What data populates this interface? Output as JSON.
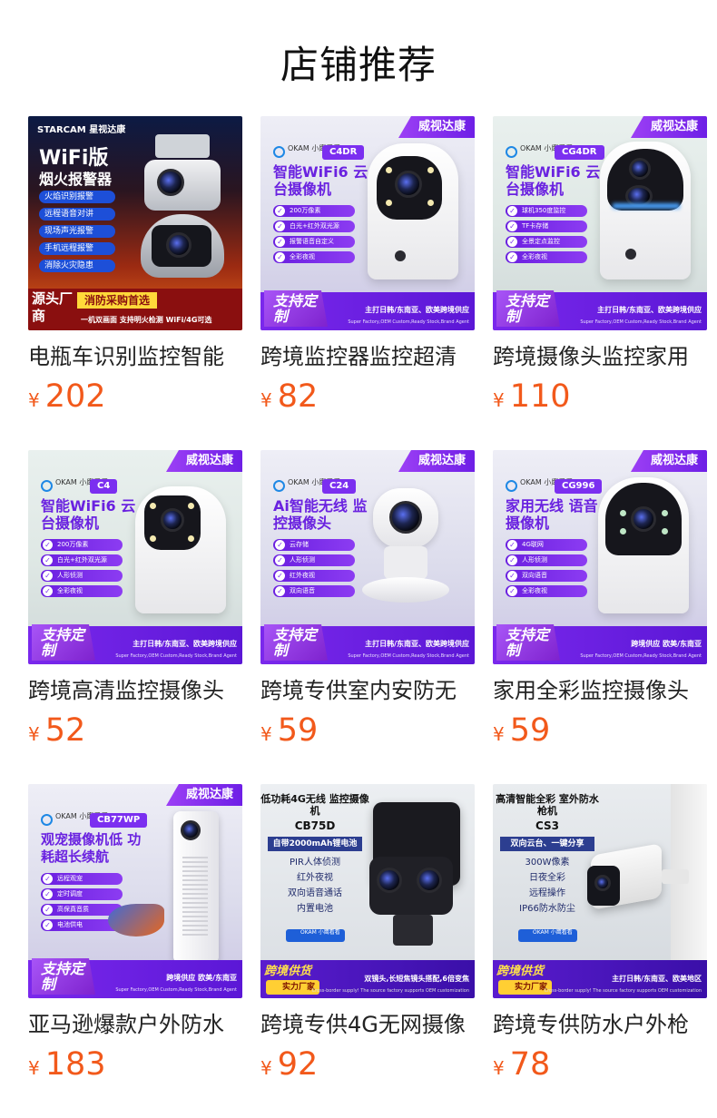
{
  "section_title": "店铺推荐",
  "products": [
    {
      "name": "电瓶车识别监控智能",
      "currency": "¥",
      "price": "202",
      "image": {
        "style": "fire",
        "brand": "STARCAM 星视达康",
        "headline": "WiFi版",
        "subheadline": "烟火报警器",
        "features": [
          "火焰识别报警",
          "远程语音对讲",
          "现场声光报警",
          "手机远程报警",
          "消除火灾隐患"
        ],
        "corner_label": "源头厂商",
        "corner_tag": "消防采购首选",
        "corner_line": "一机双画面 支持明火检测 WiFi/4G可选"
      }
    },
    {
      "name": "跨境监控器监控超清",
      "currency": "¥",
      "price": "82",
      "image": {
        "style": "purple",
        "brand_tag": "威视达康",
        "logo": "OKAM 小鹰看看",
        "model": "C4DR",
        "headline": "智能WiFi6 云台摄像机",
        "features": [
          "200万像素",
          "白光+红外双光源",
          "报警语音自定义",
          "全彩夜视"
        ],
        "customize": "支持定制",
        "bottom_text": "主打日韩/东南亚、欧美跨境供应",
        "bottom_sub": "Super Factory,OEM Custom,Ready Stock,Brand Agent"
      }
    },
    {
      "name": "跨境摄像头监控家用",
      "currency": "¥",
      "price": "110",
      "image": {
        "style": "purple",
        "brand_tag": "威视达康",
        "logo": "OKAM 小鹰看看",
        "model": "CG4DR",
        "headline": "智能WiFi6 云台摄像机",
        "features": [
          "球机350度监控",
          "TF卡存储",
          "全景定点监控",
          "全彩夜视"
        ],
        "customize": "支持定制",
        "bottom_text": "主打日韩/东南亚、欧美跨境供应",
        "bottom_sub": "Super Factory,OEM Custom,Ready Stock,Brand Agent"
      }
    },
    {
      "name": "跨境高清监控摄像头",
      "currency": "¥",
      "price": "52",
      "image": {
        "style": "purple",
        "brand_tag": "威视达康",
        "logo": "OKAM 小鹰看看",
        "model": "C4",
        "headline": "智能WiFi6 云台摄像机",
        "features": [
          "200万像素",
          "白光+红外双光源",
          "人形侦测",
          "全彩夜视"
        ],
        "customize": "支持定制",
        "bottom_text": "主打日韩/东南亚、欧美跨境供应",
        "bottom_sub": "Super Factory,OEM Custom,Ready Stock,Brand Agent"
      }
    },
    {
      "name": "跨境专供室内安防无",
      "currency": "¥",
      "price": "59",
      "image": {
        "style": "purple",
        "brand_tag": "威视达康",
        "logo": "OKAM 小鹰看看",
        "model": "C24",
        "headline": "Ai智能无线 监控摄像头",
        "features": [
          "云存储",
          "人形侦测",
          "红外夜视",
          "双向语音"
        ],
        "customize": "支持定制",
        "bottom_text": "主打日韩/东南亚、欧美跨境供应",
        "bottom_sub": "Super Factory,OEM Custom,Ready Stock,Brand Agent"
      }
    },
    {
      "name": "家用全彩监控摄像头",
      "currency": "¥",
      "price": "59",
      "image": {
        "style": "purple",
        "brand_tag": "威视达康",
        "logo": "OKAM 小鹰看看",
        "model": "CG996",
        "headline": "家用无线 语音摄像机",
        "features": [
          "4G联网",
          "人形侦测",
          "双向语音",
          "全彩夜视"
        ],
        "customize": "支持定制",
        "bottom_text": "跨境供应 欧美/东南亚",
        "bottom_sub": "Super Factory,OEM Custom,Ready Stock,Brand Agent"
      }
    },
    {
      "name": "亚马逊爆款户外防水",
      "currency": "¥",
      "price": "183",
      "image": {
        "style": "purple",
        "brand_tag": "威视达康",
        "logo": "OKAM 小鹰看看",
        "model": "CB77WP",
        "headline": "观宠摄像机低 功耗超长续航",
        "features": [
          "远程观宠",
          "定时调度",
          "高保真音质",
          "电池供电"
        ],
        "customize": "支持定制",
        "bottom_text": "跨境供应 欧美/东南亚",
        "bottom_sub": "Super Factory,OEM Custom,Ready Stock,Brand Agent"
      }
    },
    {
      "name": "跨境专供4G无网摄像",
      "currency": "¥",
      "price": "92",
      "image": {
        "style": "dark",
        "headline": "低功耗4G无线 监控摄像机",
        "model": "CB75D",
        "bar": "自带2000mAh锂电池",
        "features": [
          "PIR人体侦测",
          "红外夜视",
          "双向语音通话",
          "内置电池"
        ],
        "logo": "OKAM 小鹰看看",
        "cross_tag": "跨境供货",
        "factory": "实力厂家",
        "factory_sub": "深圳地区送货上门",
        "cross_text": "双镜头,长短焦镜头搭配,6倍变焦",
        "cross_sub": "Cross-border supply! The source factory supports OEM customization"
      }
    },
    {
      "name": "跨境专供防水户外枪",
      "currency": "¥",
      "price": "78",
      "image": {
        "style": "dark",
        "headline": "高清智能全彩 室外防水枪机",
        "model": "CS3",
        "bar": "双向云台、一键分享",
        "features": [
          "300W像素",
          "日夜全彩",
          "远程操作",
          "IP66防水防尘"
        ],
        "logo": "OKAM 小鹰看看",
        "cross_tag": "跨境供货",
        "factory": "实力厂家",
        "factory_sub": "深圳地区送货上门",
        "cross_text": "主打日韩/东南亚、欧美地区",
        "cross_sub": "Cross-border supply! The source factory supports OEM customization"
      }
    }
  ]
}
